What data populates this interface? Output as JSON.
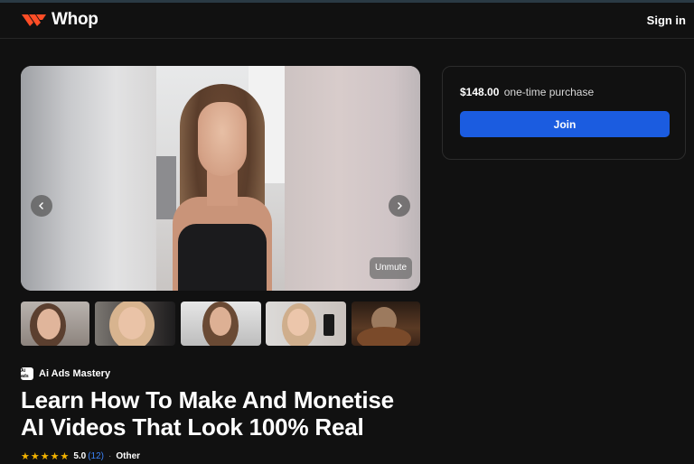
{
  "header": {
    "logo_text": "Whop",
    "sign_in_label": "Sign in",
    "brand_color": "#ff4d26"
  },
  "media": {
    "unmute_label": "Unmute",
    "thumbnails": [
      {
        "label": "thumbnail-1"
      },
      {
        "label": "thumbnail-2"
      },
      {
        "label": "thumbnail-3"
      },
      {
        "label": "thumbnail-4"
      },
      {
        "label": "thumbnail-5"
      }
    ]
  },
  "product": {
    "brand_logo_text": "Ai ads",
    "brand_name": "Ai Ads Mastery",
    "title_line1": "Learn How To Make And Monetise",
    "title_line2": "AI Videos That Look 100% Real",
    "stars": "★★★★★",
    "rating": "5.0",
    "review_count": "(12)",
    "separator": "·",
    "category": "Other"
  },
  "purchase": {
    "price": "$148.00",
    "price_note": "one-time purchase",
    "join_label": "Join",
    "accent_color": "#1b5ce0"
  }
}
